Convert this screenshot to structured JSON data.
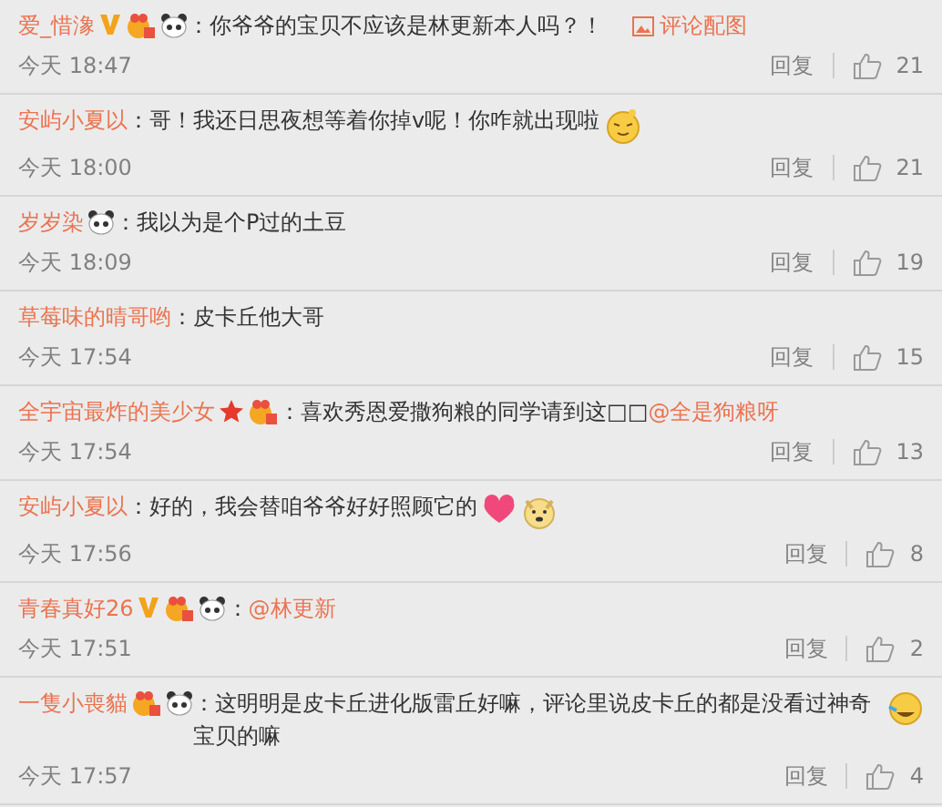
{
  "comments": [
    {
      "user": "爱_惜潒",
      "badges": [
        {
          "kind": "vip"
        },
        {
          "kind": "medal"
        },
        {
          "kind": "panda"
        }
      ],
      "text": "：你爷爷的宝贝不应该是林更新本人吗？！",
      "attachment_link": "评论配图",
      "time": "今天 18:47",
      "reply": "回复",
      "likes": "21"
    },
    {
      "user": "安屿小夏以",
      "text": "：哥！我还日思夜想等着你掉v呢！你咋就出现啦",
      "emojis": [
        {
          "kind": "dizzy"
        }
      ],
      "time": "今天 18:00",
      "reply": "回复",
      "likes": "21"
    },
    {
      "user": "岁岁染",
      "badges": [
        {
          "kind": "panda"
        }
      ],
      "text": "：我以为是个P过的土豆",
      "time": "今天 18:09",
      "reply": "回复",
      "likes": "19"
    },
    {
      "user": "草莓味的晴哥哟",
      "text": "：皮卡丘他大哥",
      "time": "今天 17:54",
      "reply": "回复",
      "likes": "15"
    },
    {
      "user": "全宇宙最炸的美少女",
      "badges": [
        {
          "kind": "star"
        },
        {
          "kind": "medal"
        }
      ],
      "text": "：喜欢秀恩爱撒狗粮的同学请到这□□",
      "mention": "@全是狗粮呀",
      "time": "今天 17:54",
      "reply": "回复",
      "likes": "13"
    },
    {
      "user": "安屿小夏以",
      "text": "：好的，我会替咱爷爷好好照顾它的",
      "emojis": [
        {
          "kind": "heart"
        },
        {
          "kind": "dog"
        }
      ],
      "time": "今天 17:56",
      "reply": "回复",
      "likes": "8"
    },
    {
      "user": "青春真好26",
      "badges": [
        {
          "kind": "vip"
        },
        {
          "kind": "medal"
        },
        {
          "kind": "panda"
        }
      ],
      "text": "：",
      "mention": "@林更新",
      "time": "今天 17:51",
      "reply": "回复",
      "likes": "2"
    },
    {
      "user": "一隻小喪貓",
      "badges": [
        {
          "kind": "medal"
        },
        {
          "kind": "panda"
        }
      ],
      "text": "：这明明是皮卡丘进化版雷丘好嘛，评论里说皮卡丘的都是没看过神奇宝贝的嘛",
      "emojis": [
        {
          "kind": "laugh"
        }
      ],
      "time": "今天 17:57",
      "reply": "回复",
      "likes": "4"
    }
  ]
}
